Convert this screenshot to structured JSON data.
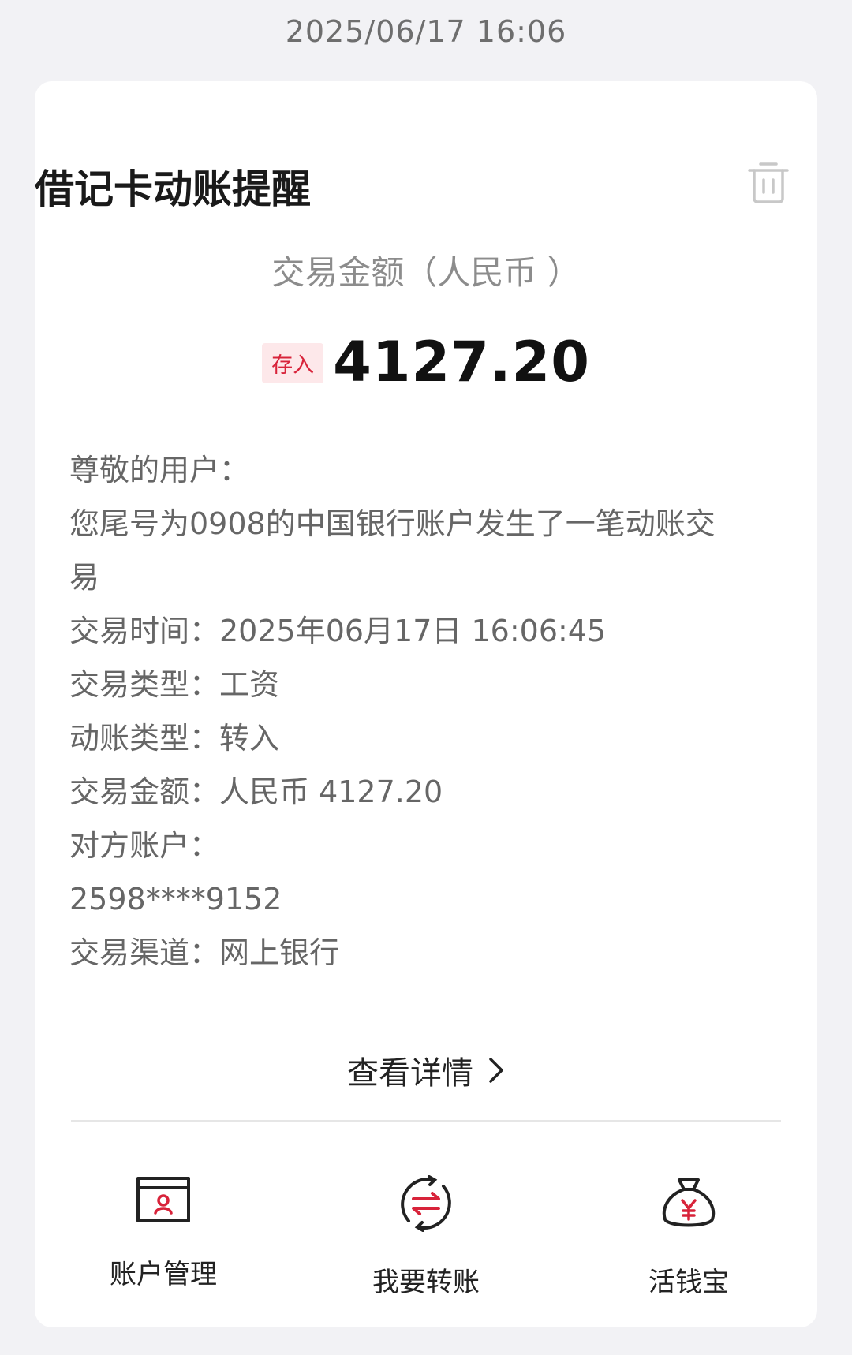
{
  "timestamp": "2025/06/17 16:06",
  "card": {
    "title": "借记卡动账提醒",
    "amount_label": "交易金额（人民币 ）",
    "badge": "存入",
    "amount": "4127.20",
    "lines": [
      "尊敬的用户：",
      "您尾号为0908的中国银行账户发生了一笔动账交",
      "易",
      "交易时间：2025年06月17日 16:06:45",
      "交易类型：工资",
      "动账类型：转入",
      "交易金额：人民币 4127.20",
      "对方账户：",
      "2598****9152",
      "交易渠道：网上银行"
    ],
    "detail_link": "查看详情"
  },
  "actions": [
    {
      "label": "账户管理",
      "icon": "account-card-icon"
    },
    {
      "label": "我要转账",
      "icon": "transfer-icon"
    },
    {
      "label": "活钱宝",
      "icon": "money-bag-icon"
    }
  ],
  "colors": {
    "accent": "#d8233a",
    "background": "#f2f2f5",
    "card": "#ffffff"
  }
}
